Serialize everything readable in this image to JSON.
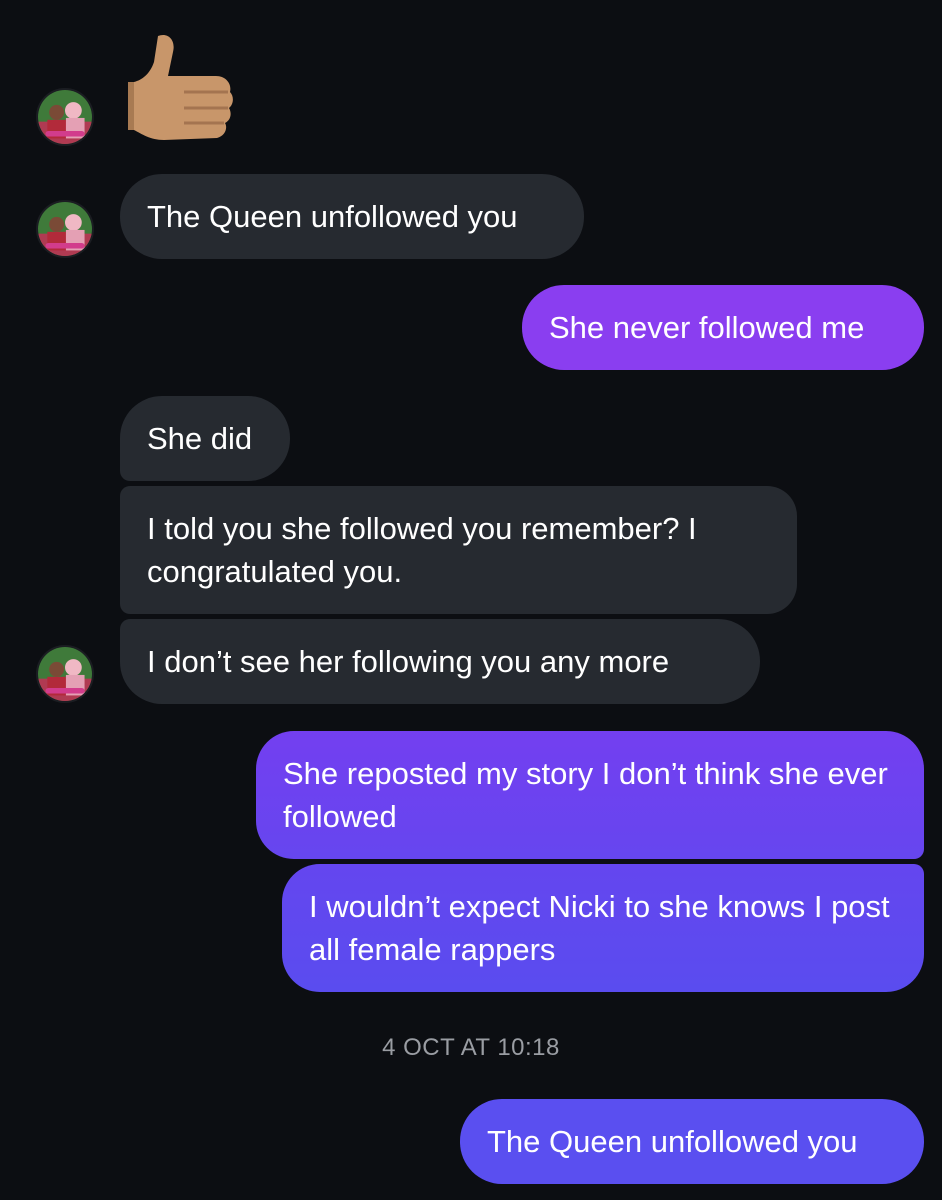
{
  "conversation": {
    "reaction_emoji": "thumbs-up-icon",
    "messages": [
      {
        "from": "them",
        "text": "The Queen unfollowed you"
      },
      {
        "from": "me",
        "text": "She never followed me"
      },
      {
        "from": "them",
        "text": "She did"
      },
      {
        "from": "them",
        "text": "I told you she followed you remember? I congratulated you."
      },
      {
        "from": "them",
        "text": "I don’t see her following you any more"
      },
      {
        "from": "me",
        "text": "She reposted my story I don’t think she ever followed"
      },
      {
        "from": "me",
        "text": "I wouldn’t expect Nicki to she knows I post all female rappers"
      },
      {
        "from": "me",
        "text": "The Queen unfollowed you"
      }
    ],
    "timestamp": "4 OCT AT 10:18"
  },
  "colors": {
    "background": "#0c0e12",
    "incoming_bubble": "#262a30",
    "outgoing_gradient_top": "#8a3cf0",
    "outgoing_gradient_bottom": "#5a4ef0",
    "timestamp_text": "#9a9da3"
  }
}
